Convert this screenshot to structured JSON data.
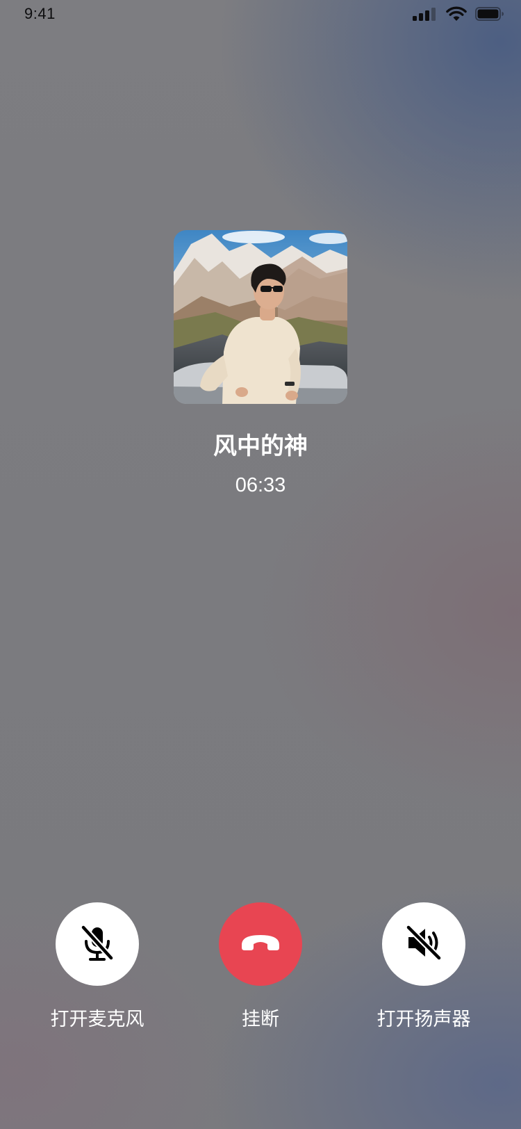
{
  "status_bar": {
    "time": "9:41",
    "icons": [
      "cellular-signal-icon",
      "wifi-icon",
      "battery-icon"
    ]
  },
  "call": {
    "avatar_icon": "avatar-photo",
    "caller_name": "风中的神",
    "duration": "06:33"
  },
  "controls": {
    "microphone": {
      "label": "打开麦克风",
      "icon": "microphone-muted-icon",
      "state": "off"
    },
    "hangup": {
      "label": "挂断",
      "icon": "phone-hangup-icon",
      "color": "#e84552"
    },
    "speaker": {
      "label": "打开扬声器",
      "icon": "speaker-muted-icon",
      "state": "off"
    }
  }
}
